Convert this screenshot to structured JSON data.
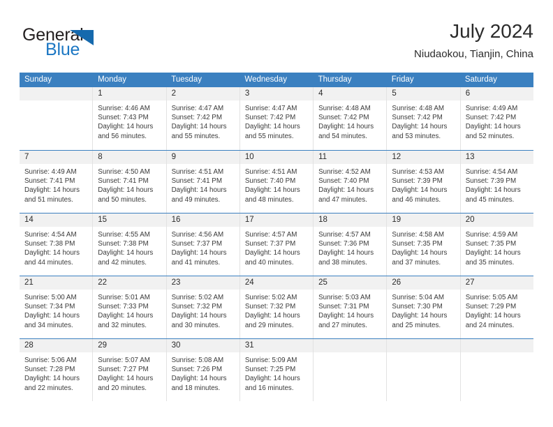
{
  "brand": {
    "word_one": "General",
    "word_two": "Blue",
    "triangle_color": "#1569ad",
    "blue_color": "#1c77c3"
  },
  "header": {
    "title": "July 2024",
    "location": "Niudaokou, Tianjin, China"
  },
  "theme": {
    "header_blue": "#3b80c0",
    "day_number_bg": "#f1f1f1",
    "cell_border": "#e2e2e2",
    "text": "#3a3a3a"
  },
  "weekdays": [
    "Sunday",
    "Monday",
    "Tuesday",
    "Wednesday",
    "Thursday",
    "Friday",
    "Saturday"
  ],
  "weeks": [
    [
      {
        "day": "",
        "empty": true
      },
      {
        "day": "1",
        "sunrise": "Sunrise: 4:46 AM",
        "sunset": "Sunset: 7:43 PM",
        "daylight_line1": "Daylight: 14 hours",
        "daylight_line2": "and 56 minutes."
      },
      {
        "day": "2",
        "sunrise": "Sunrise: 4:47 AM",
        "sunset": "Sunset: 7:42 PM",
        "daylight_line1": "Daylight: 14 hours",
        "daylight_line2": "and 55 minutes."
      },
      {
        "day": "3",
        "sunrise": "Sunrise: 4:47 AM",
        "sunset": "Sunset: 7:42 PM",
        "daylight_line1": "Daylight: 14 hours",
        "daylight_line2": "and 55 minutes."
      },
      {
        "day": "4",
        "sunrise": "Sunrise: 4:48 AM",
        "sunset": "Sunset: 7:42 PM",
        "daylight_line1": "Daylight: 14 hours",
        "daylight_line2": "and 54 minutes."
      },
      {
        "day": "5",
        "sunrise": "Sunrise: 4:48 AM",
        "sunset": "Sunset: 7:42 PM",
        "daylight_line1": "Daylight: 14 hours",
        "daylight_line2": "and 53 minutes."
      },
      {
        "day": "6",
        "sunrise": "Sunrise: 4:49 AM",
        "sunset": "Sunset: 7:42 PM",
        "daylight_line1": "Daylight: 14 hours",
        "daylight_line2": "and 52 minutes."
      }
    ],
    [
      {
        "day": "7",
        "sunrise": "Sunrise: 4:49 AM",
        "sunset": "Sunset: 7:41 PM",
        "daylight_line1": "Daylight: 14 hours",
        "daylight_line2": "and 51 minutes."
      },
      {
        "day": "8",
        "sunrise": "Sunrise: 4:50 AM",
        "sunset": "Sunset: 7:41 PM",
        "daylight_line1": "Daylight: 14 hours",
        "daylight_line2": "and 50 minutes."
      },
      {
        "day": "9",
        "sunrise": "Sunrise: 4:51 AM",
        "sunset": "Sunset: 7:41 PM",
        "daylight_line1": "Daylight: 14 hours",
        "daylight_line2": "and 49 minutes."
      },
      {
        "day": "10",
        "sunrise": "Sunrise: 4:51 AM",
        "sunset": "Sunset: 7:40 PM",
        "daylight_line1": "Daylight: 14 hours",
        "daylight_line2": "and 48 minutes."
      },
      {
        "day": "11",
        "sunrise": "Sunrise: 4:52 AM",
        "sunset": "Sunset: 7:40 PM",
        "daylight_line1": "Daylight: 14 hours",
        "daylight_line2": "and 47 minutes."
      },
      {
        "day": "12",
        "sunrise": "Sunrise: 4:53 AM",
        "sunset": "Sunset: 7:39 PM",
        "daylight_line1": "Daylight: 14 hours",
        "daylight_line2": "and 46 minutes."
      },
      {
        "day": "13",
        "sunrise": "Sunrise: 4:54 AM",
        "sunset": "Sunset: 7:39 PM",
        "daylight_line1": "Daylight: 14 hours",
        "daylight_line2": "and 45 minutes."
      }
    ],
    [
      {
        "day": "14",
        "sunrise": "Sunrise: 4:54 AM",
        "sunset": "Sunset: 7:38 PM",
        "daylight_line1": "Daylight: 14 hours",
        "daylight_line2": "and 44 minutes."
      },
      {
        "day": "15",
        "sunrise": "Sunrise: 4:55 AM",
        "sunset": "Sunset: 7:38 PM",
        "daylight_line1": "Daylight: 14 hours",
        "daylight_line2": "and 42 minutes."
      },
      {
        "day": "16",
        "sunrise": "Sunrise: 4:56 AM",
        "sunset": "Sunset: 7:37 PM",
        "daylight_line1": "Daylight: 14 hours",
        "daylight_line2": "and 41 minutes."
      },
      {
        "day": "17",
        "sunrise": "Sunrise: 4:57 AM",
        "sunset": "Sunset: 7:37 PM",
        "daylight_line1": "Daylight: 14 hours",
        "daylight_line2": "and 40 minutes."
      },
      {
        "day": "18",
        "sunrise": "Sunrise: 4:57 AM",
        "sunset": "Sunset: 7:36 PM",
        "daylight_line1": "Daylight: 14 hours",
        "daylight_line2": "and 38 minutes."
      },
      {
        "day": "19",
        "sunrise": "Sunrise: 4:58 AM",
        "sunset": "Sunset: 7:35 PM",
        "daylight_line1": "Daylight: 14 hours",
        "daylight_line2": "and 37 minutes."
      },
      {
        "day": "20",
        "sunrise": "Sunrise: 4:59 AM",
        "sunset": "Sunset: 7:35 PM",
        "daylight_line1": "Daylight: 14 hours",
        "daylight_line2": "and 35 minutes."
      }
    ],
    [
      {
        "day": "21",
        "sunrise": "Sunrise: 5:00 AM",
        "sunset": "Sunset: 7:34 PM",
        "daylight_line1": "Daylight: 14 hours",
        "daylight_line2": "and 34 minutes."
      },
      {
        "day": "22",
        "sunrise": "Sunrise: 5:01 AM",
        "sunset": "Sunset: 7:33 PM",
        "daylight_line1": "Daylight: 14 hours",
        "daylight_line2": "and 32 minutes."
      },
      {
        "day": "23",
        "sunrise": "Sunrise: 5:02 AM",
        "sunset": "Sunset: 7:32 PM",
        "daylight_line1": "Daylight: 14 hours",
        "daylight_line2": "and 30 minutes."
      },
      {
        "day": "24",
        "sunrise": "Sunrise: 5:02 AM",
        "sunset": "Sunset: 7:32 PM",
        "daylight_line1": "Daylight: 14 hours",
        "daylight_line2": "and 29 minutes."
      },
      {
        "day": "25",
        "sunrise": "Sunrise: 5:03 AM",
        "sunset": "Sunset: 7:31 PM",
        "daylight_line1": "Daylight: 14 hours",
        "daylight_line2": "and 27 minutes."
      },
      {
        "day": "26",
        "sunrise": "Sunrise: 5:04 AM",
        "sunset": "Sunset: 7:30 PM",
        "daylight_line1": "Daylight: 14 hours",
        "daylight_line2": "and 25 minutes."
      },
      {
        "day": "27",
        "sunrise": "Sunrise: 5:05 AM",
        "sunset": "Sunset: 7:29 PM",
        "daylight_line1": "Daylight: 14 hours",
        "daylight_line2": "and 24 minutes."
      }
    ],
    [
      {
        "day": "28",
        "sunrise": "Sunrise: 5:06 AM",
        "sunset": "Sunset: 7:28 PM",
        "daylight_line1": "Daylight: 14 hours",
        "daylight_line2": "and 22 minutes."
      },
      {
        "day": "29",
        "sunrise": "Sunrise: 5:07 AM",
        "sunset": "Sunset: 7:27 PM",
        "daylight_line1": "Daylight: 14 hours",
        "daylight_line2": "and 20 minutes."
      },
      {
        "day": "30",
        "sunrise": "Sunrise: 5:08 AM",
        "sunset": "Sunset: 7:26 PM",
        "daylight_line1": "Daylight: 14 hours",
        "daylight_line2": "and 18 minutes."
      },
      {
        "day": "31",
        "sunrise": "Sunrise: 5:09 AM",
        "sunset": "Sunset: 7:25 PM",
        "daylight_line1": "Daylight: 14 hours",
        "daylight_line2": "and 16 minutes."
      },
      {
        "day": "",
        "empty": true
      },
      {
        "day": "",
        "empty": true
      },
      {
        "day": "",
        "empty": true
      }
    ]
  ]
}
